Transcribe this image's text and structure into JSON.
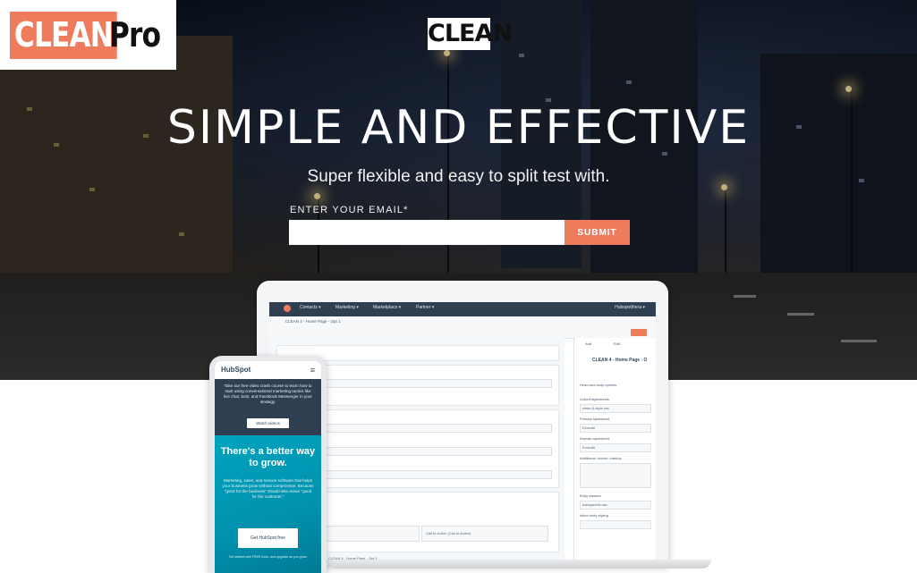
{
  "brand": {
    "clean": "CLEAN",
    "pro": "Pro"
  },
  "hero": {
    "logo": "CLEAN",
    "headline": "SIMPLE AND EFFECTIVE",
    "subheadline": "Super flexible and easy to split test with.",
    "email_label": "ENTER YOUR EMAIL*",
    "email_value": "",
    "submit_label": "SUBMIT"
  },
  "laptop": {
    "nav_items": [
      "Contacts ▾",
      "Marketing ▾",
      "Marketplace ▾",
      "Partner ▾"
    ],
    "account": "Hubspotthera ▾",
    "tab_title": "CLEAN 4 - Home Page - Opt 1",
    "editor_title": "CLEAN 4 - Home Page - O",
    "panel_tabs": [
      "Add",
      "Edit"
    ],
    "panel_section": "Head and body options",
    "panel_labels": [
      "Linked stylesheets",
      "Primary stylesheet",
      "Domain stylesheet",
      "Additional <head> markup",
      "Body classes",
      "Inline body styling"
    ],
    "panel_values": [
      "clean-4-style.css",
      "Exclude",
      "Exclude",
      "",
      "transparent-nav",
      ""
    ],
    "cta_labels": [
      "CTA (Call to Action)",
      "Call to Action (Call to Action)"
    ],
    "footer_crumb": "CLEAN 4 - Home Page - Opt 1"
  },
  "phone": {
    "logo": "HubSpot",
    "menu_icon": "≡",
    "intro": "Take our free video crash course to learn how to start using conversational marketing tactics like live chat, bots, and Facebook Messenger in your strategy.",
    "watch_label": "Watch videos",
    "heading": "There's a better way to grow.",
    "body": "Marketing, sales, and service software that helps your business grow without compromise. Because \"good for the business\" should also mean \"good for the customer.\"",
    "cta_label": "Get HubSpot free",
    "footer": "Get started with FREE tools, and upgrade as you grow."
  },
  "colors": {
    "accent": "#ee7b5c",
    "teal": "#00a4bd",
    "navy": "#2e3f52"
  }
}
